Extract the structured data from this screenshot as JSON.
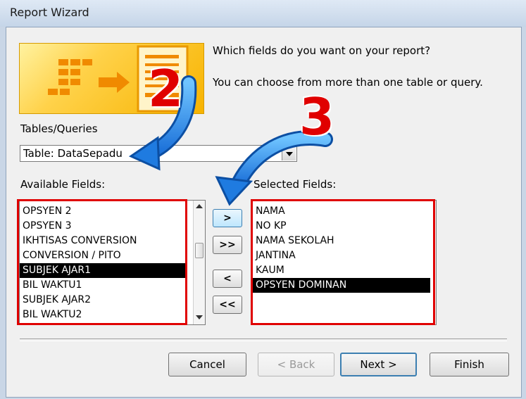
{
  "window": {
    "title": "Report Wizard"
  },
  "header": {
    "question": "Which fields do you want on your report?",
    "hint": "You can choose from more than one table or query."
  },
  "tables": {
    "label": "Tables/Queries",
    "selected": "Table: DataSepadu"
  },
  "available": {
    "label": "Available Fields:",
    "items": [
      "OPSYEN 2",
      "OPSYEN 3",
      "IKHTISAS CONVERSION",
      "CONVERSION / PITO",
      "SUBJEK AJAR1",
      "BIL WAKTU1",
      "SUBJEK AJAR2",
      "BIL WAKTU2"
    ],
    "selected_index": 4
  },
  "selected": {
    "label": "Selected Fields:",
    "items": [
      "NAMA",
      "NO KP",
      "NAMA SEKOLAH",
      "JANTINA",
      "KAUM",
      "OPSYEN DOMINAN"
    ],
    "selected_index": 5
  },
  "move_buttons": {
    "add_one": ">",
    "add_all": ">>",
    "remove_one": "<",
    "remove_all": "<<"
  },
  "buttons": {
    "cancel": "Cancel",
    "back": "< Back",
    "next": "Next >",
    "finish": "Finish"
  },
  "annotations": {
    "step2": "2",
    "step3": "3"
  },
  "colors": {
    "annotation_red": "#e00000",
    "arrow_blue": "#1f7be0"
  }
}
